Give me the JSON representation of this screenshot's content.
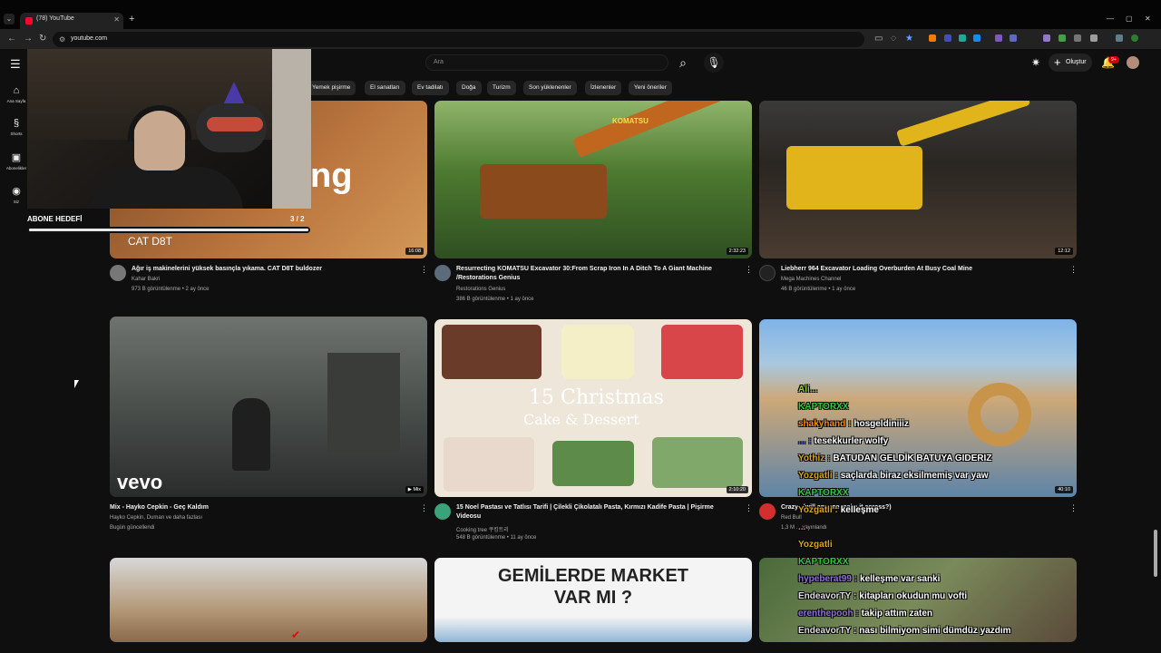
{
  "browser": {
    "tab_title": "(78) YouTube",
    "url": "youtube.com"
  },
  "header": {
    "search_placeholder": "Ara",
    "create_label": "Oluştur",
    "notification_count": "9+"
  },
  "sidebar": {
    "items": [
      {
        "label": "Ana Sayfa",
        "icon": "home-icon"
      },
      {
        "label": "Shorts",
        "icon": "shorts-icon"
      },
      {
        "label": "Abonelikler",
        "icon": "subscriptions-icon"
      },
      {
        "label": "Siz",
        "icon": "you-icon"
      }
    ]
  },
  "chips": [
    "Yemek pişirme",
    "El sanatları",
    "Ev tadilatı",
    "Doğa",
    "Turizm",
    "Son yüklenenler",
    "İzlenenler",
    "Yeni öneriler"
  ],
  "goal": {
    "label": "ABONE HEDEFİ",
    "count": "3 / 2",
    "progress": 1.0
  },
  "videos": [
    {
      "title": "Ağır iş makinelerini yüksek basınçla yıkama. CAT D8T buldozer",
      "channel": "Kahar Bakri",
      "meta": "973 B görüntülenme • 2 ay önce",
      "duration": "16:08",
      "thumb_text": "ng",
      "thumb_sub": "CAT D8T"
    },
    {
      "title": "Resurrecting KOMATSU Excavator 30:From Scrap Iron In A Ditch To A Giant Machine /Restorations Genius",
      "channel": "Restorations Genius",
      "meta": "386 B görüntülenme • 1 ay önce",
      "duration": "2:32:23",
      "thumb_text": "KOMATSU"
    },
    {
      "title": "Liebherr 964 Excavator Loading Overburden At Busy Coal Mine",
      "channel": "Mega Machines Channel",
      "meta": "46 B görüntülenme • 1 ay önce",
      "duration": "12:12"
    },
    {
      "title": "Mix - Hayko Cepkin - Geç Kaldım",
      "channel": "Hayko Cepkin, Duman ve daha fazlası",
      "meta": "Bugün güncellendi",
      "duration": "▶ Mix",
      "thumb_text": "vevo"
    },
    {
      "title": "15 Noel Pastası ve Tatlısı Tarifi | Çilekli Çikolatalı Pasta, Kırmızı Kadife Pasta | Pişirme Videosu",
      "channel": "Cooking tree 쿠킹트리",
      "meta": "548 B görüntülenme • 11 ay önce",
      "duration": "2:10:20",
      "thumb_text": "15 Christmas",
      "thumb_sub": "Cake & Dessert"
    },
    {
      "title": "Crazy...(will anyone make it across?)",
      "channel": "Red Bull",
      "meta": "1,3 M ... yayınlandı",
      "duration": "40:10"
    },
    {
      "title": "",
      "channel": "",
      "meta": "",
      "duration": ""
    },
    {
      "title": "",
      "channel": "",
      "meta": "",
      "duration": "",
      "thumb_text": "GEMİLERDE MARKET VAR MI ?"
    },
    {
      "title": "",
      "channel": "",
      "meta": "",
      "duration": ""
    }
  ],
  "chat": [
    {
      "user": "Ali...",
      "msg": "",
      "color": "#9acd32"
    },
    {
      "user": "KAPTORXX",
      "msg": "",
      "color": "#2ecc40"
    },
    {
      "user": "shakyhand",
      "msg": "hosgeldiniiiz",
      "color": "#ff8c00"
    },
    {
      "user": "...",
      "msg": "tesekkurler wolfy",
      "color": "#0000ff"
    },
    {
      "user": "Yothiz",
      "msg": "BATUDAN GELDİK BATUYA GIDERIZ",
      "color": "#daa520"
    },
    {
      "user": "Yozgatli",
      "msg": "saçlarda biraz eksilmemiş var yaw",
      "color": "#daa520"
    },
    {
      "user": "KAPTORXX",
      "msg": "",
      "color": "#2ecc40"
    },
    {
      "user": "Yozgatli",
      "msg": "kelleşme",
      "color": "#daa520"
    },
    {
      "user": "...",
      "msg": "",
      "color": "#ff69b4"
    },
    {
      "user": "Yozgatli",
      "msg": "",
      "color": "#daa520"
    },
    {
      "user": "KAPTORXX",
      "msg": "",
      "color": "#2ecc40"
    },
    {
      "user": "hypeberat99",
      "msg": "kelleşme var sanki",
      "color": "#9370db"
    },
    {
      "user": "EndeavorTY",
      "msg": "kitapları okudun mu vofti",
      "color": "#dddddd"
    },
    {
      "user": "erenthepooh",
      "msg": "takip attım zaten",
      "color": "#9370db"
    },
    {
      "user": "EndeavorTY",
      "msg": "nası bilmiyom simi dümdüz yazdım",
      "color": "#dddddd"
    }
  ],
  "colors": {
    "background": "#0f0f0f",
    "accent": "#ff0000",
    "chip": "#272727"
  }
}
